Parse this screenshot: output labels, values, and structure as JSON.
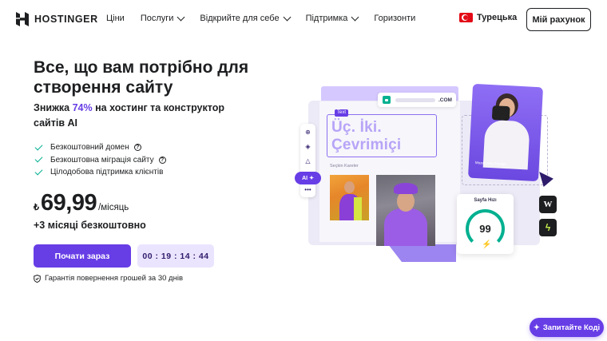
{
  "header": {
    "brand": "HOSTINGER",
    "nav": [
      {
        "label": "Ціни",
        "dropdown": false
      },
      {
        "label": "Послуги",
        "dropdown": true
      },
      {
        "label": "Відкрийте для себе",
        "dropdown": true
      },
      {
        "label": "Підтримка",
        "dropdown": true
      },
      {
        "label": "Горизонти",
        "dropdown": false
      }
    ],
    "language": "Турецька",
    "account_button": "Мій рахунок"
  },
  "hero": {
    "title": "Все, що вам потрібно для створення сайту",
    "subtitle_prefix": "Знижка ",
    "subtitle_discount": "74%",
    "subtitle_suffix": " на хостинг та конструктор сайтів AI",
    "features": [
      {
        "text": "Безкоштовний домен",
        "has_info": true
      },
      {
        "text": "Безкоштовна міграція сайту",
        "has_info": true
      },
      {
        "text": "Цілодобова підтримка клієнтів",
        "has_info": false
      }
    ],
    "currency": "₺",
    "price": "69,99",
    "period": "/місяць",
    "bonus": "+3 місяці безкоштовно",
    "cta_label": "Почати зараз",
    "timer": "00 : 19 : 14 : 44",
    "guarantee": "Гарантія повернення грошей за 30 днів"
  },
  "illustration": {
    "url_tld": ".COM",
    "text_tag": "Text",
    "headline": "Üç. İki. Çevrimiçi",
    "gallery_label": "Seçkin Kareler",
    "ai_label": "AI",
    "portrait_caption": "Mozeh Ann Frangle",
    "speed_label": "Sayfa Hızı",
    "speed_score": "99",
    "wp_badge": "W"
  },
  "chat": {
    "label": "Запитайте Коді"
  },
  "colors": {
    "accent": "#673de6",
    "success": "#00b090",
    "text": "#1d1e20",
    "timer_bg": "#ebe4ff"
  }
}
